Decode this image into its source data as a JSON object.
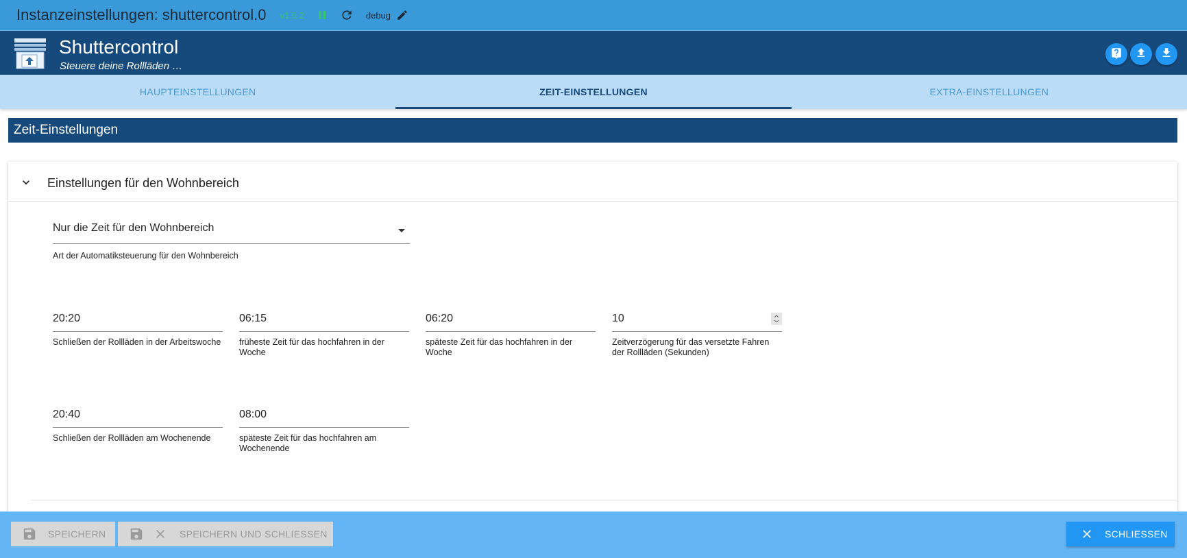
{
  "titlebar": {
    "title": "Instanzeinstellungen: shuttercontrol.0",
    "version": "v1.6.2",
    "loglevel": "debug",
    "icons": [
      "pause-icon",
      "refresh-icon",
      "pencil-icon"
    ]
  },
  "header": {
    "app_title": "Shuttercontrol",
    "app_subtitle": "Steuere deine Rollläden …",
    "icons": [
      "help-icon",
      "upload-icon",
      "download-icon"
    ]
  },
  "tabs": [
    {
      "label": "HAUPTEINSTELLUNGEN",
      "active": false
    },
    {
      "label": "ZEIT-EINSTELLUNGEN",
      "active": true
    },
    {
      "label": "EXTRA-EINSTELLUNGEN",
      "active": false
    }
  ],
  "section": {
    "title": "Zeit-Einstellungen"
  },
  "panel": {
    "title": "Einstellungen für den Wohnbereich",
    "select": {
      "value": "Nur die Zeit für den Wohnbereich",
      "helper": "Art der Automatiksteuerung für den Wohnbereich"
    },
    "fields": [
      {
        "value": "20:20",
        "label": "Schließen der Rollläden in der Arbeitswoche"
      },
      {
        "value": "06:15",
        "label": "früheste Zeit für das hochfahren in der Woche"
      },
      {
        "value": "06:20",
        "label": "späteste Zeit für das hochfahren in der Woche"
      },
      {
        "value": "10",
        "label": "Zeitverzögerung für das versetzte Fahren der Rollläden (Sekunden)"
      },
      {
        "value": "20:40",
        "label": "Schließen der Rollläden am Wochenende"
      },
      {
        "value": "08:00",
        "label": "späteste Zeit für das hochfahren am Wochenende"
      }
    ]
  },
  "footer": {
    "save_label": "SPEICHERN",
    "save_close_label": "SPEICHERN UND SCHLIESSEN",
    "close_label": "SCHLIESSEN"
  },
  "colors": {
    "titlebar": "#3a9ad9",
    "header": "#174a7c",
    "tabs": "#bbdcf6",
    "footer": "#64b5f6",
    "accent": "#2196f3"
  }
}
